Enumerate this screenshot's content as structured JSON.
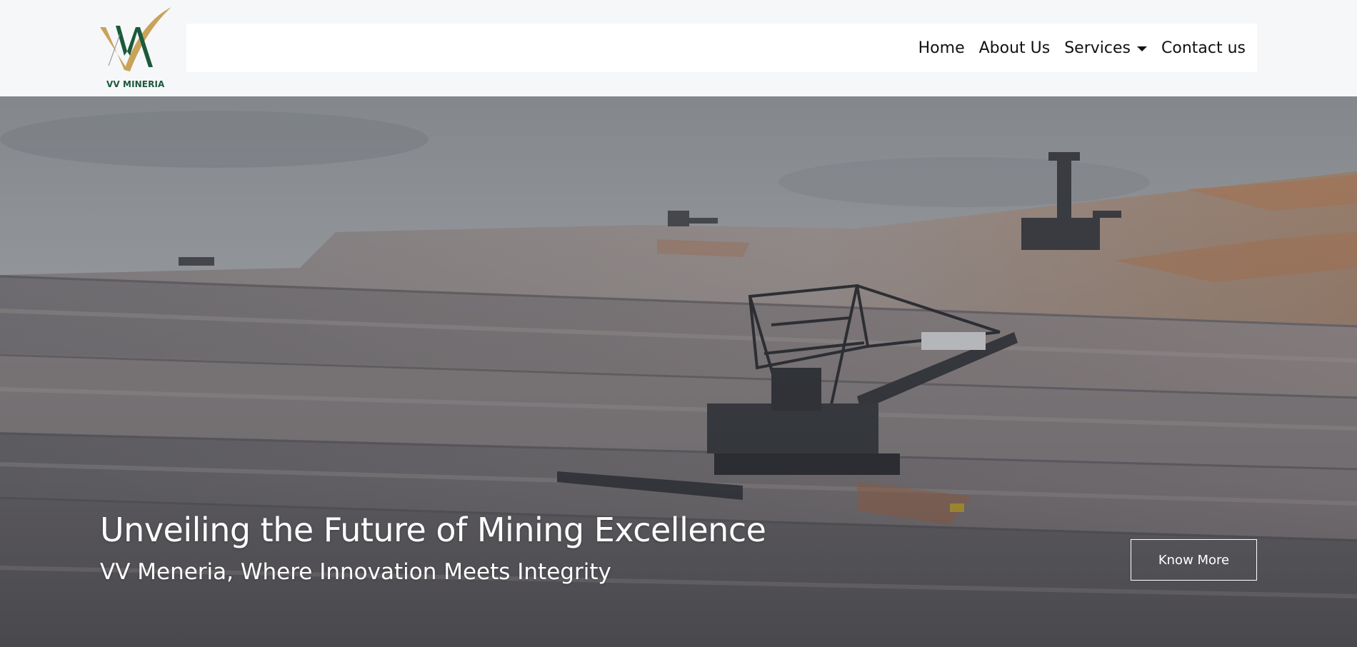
{
  "brand": {
    "logo_text": "VV MINERIA",
    "colors": {
      "gold": "#c9a35a",
      "green": "#1b5a3a"
    }
  },
  "nav": {
    "items": [
      {
        "label": "Home"
      },
      {
        "label": "About Us"
      },
      {
        "label": "Services",
        "has_dropdown": true
      },
      {
        "label": "Contact us"
      }
    ]
  },
  "hero": {
    "title": "Unveiling the Future of Mining Excellence",
    "subtitle": "VV Meneria, Where Innovation Meets Integrity",
    "cta_label": "Know More",
    "background_image": "open-pit-mine-bucket-wheel-excavator"
  }
}
